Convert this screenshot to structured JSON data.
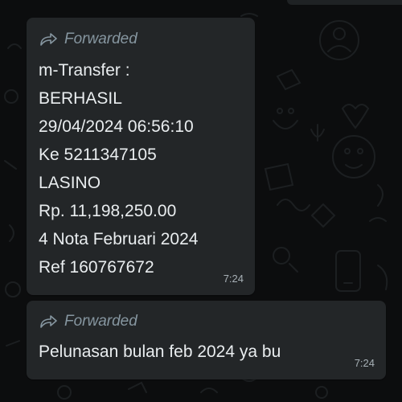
{
  "theme": {
    "bubble_color": "#232628",
    "text_color": "#e9edef",
    "meta_color": "#8696a0",
    "background": "#0c0d0e"
  },
  "messages": [
    {
      "forwarded_label": "Forwarded",
      "forward_icon": "forward-arrow-icon",
      "lines": [
        "m-Transfer :",
        "BERHASIL",
        "29/04/2024 06:56:10",
        "Ke 5211347105",
        "LASINO",
        "Rp. 11,198,250.00",
        "4 Nota Februari 2024",
        "Ref 160767672"
      ],
      "time": "7:24"
    },
    {
      "forwarded_label": "Forwarded",
      "forward_icon": "forward-arrow-icon",
      "lines": [
        "Pelunasan bulan feb 2024 ya bu"
      ],
      "time": "7:24"
    }
  ]
}
